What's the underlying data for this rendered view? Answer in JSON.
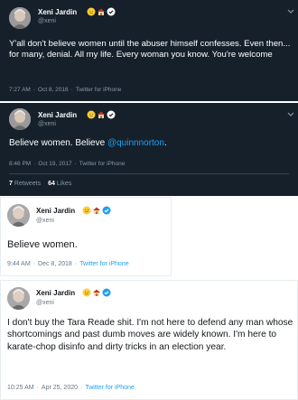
{
  "tweets": [
    {
      "name": "Xeni Jardin",
      "handle": "@xeni",
      "emojis": [
        "sun-with-face-icon",
        "house-icon",
        "verified-badge-icon"
      ],
      "text": "Y'all don't believe women until the abuser himself confesses. Even then... for many, denial. All my life. Every woman you know. You're welcome",
      "time": "7:27 AM",
      "date": "Oct 8, 2016",
      "source": "Twitter for iPhone"
    },
    {
      "name": "Xeni Jardin",
      "handle": "@xeni",
      "emojis": [
        "sun-with-face-icon",
        "house-icon",
        "verified-badge-icon"
      ],
      "text_prefix": "Believe women. Believe ",
      "mention": "@quinnnorton",
      "text_suffix": ".",
      "time": "8:46 PM",
      "date": "Oct 19, 2017",
      "source": "Twitter for iPhone",
      "retweets_count": "7",
      "retweets_label": "Retweets",
      "likes_count": "64",
      "likes_label": "Likes"
    },
    {
      "name": "Xeni Jardin",
      "handle": "@xeni",
      "emojis": [
        "sun-with-face-icon",
        "house-icon",
        "verified-badge-icon"
      ],
      "text": "Believe women.",
      "time": "9:44 AM",
      "date": "Dec 8, 2018",
      "source": "Twitter for iPhone"
    },
    {
      "name": "Xeni Jardin",
      "handle": "@xeni",
      "emojis": [
        "sun-with-face-icon",
        "house-icon",
        "verified-badge-icon"
      ],
      "text": "I don't buy the Tara Reade shit. I'm not here to defend any man whose shortcomings and past dumb moves are widely known. I'm here to karate-chop disinfo and dirty tricks in an election year.",
      "time": "10:25 AM",
      "date": "Apr 25, 2020",
      "source": "Twitter for iPhone"
    }
  ],
  "separator": "·",
  "colors": {
    "dark_bg": "#15202b",
    "link_blue": "#1da1f2",
    "verified_blue": "#1da1f2",
    "muted_dark": "#8899a6",
    "muted_light": "#657786"
  }
}
